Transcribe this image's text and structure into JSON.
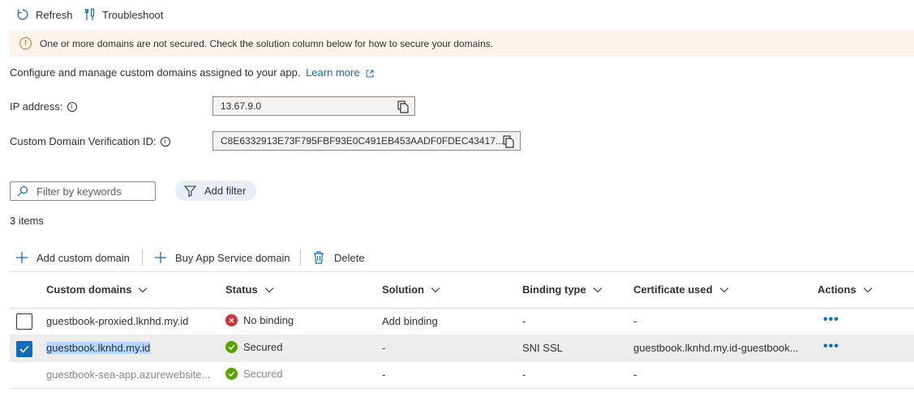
{
  "toolbar": {
    "refresh_label": "Refresh",
    "troubleshoot_label": "Troubleshoot"
  },
  "banner": {
    "message": "One or more domains are not secured. Check the solution column below for how to secure your domains."
  },
  "intro": {
    "text": "Configure and manage custom domains assigned to your app.",
    "learn_more": "Learn more"
  },
  "ip": {
    "label": "IP address:",
    "value": "13.67.9.0"
  },
  "verification": {
    "label": "Custom Domain Verification ID:",
    "value": "C8E6332913E73F795FBF93E0C491EB453AADF0FDEC43417..."
  },
  "filter": {
    "placeholder": "Filter by keywords",
    "add_filter_label": "Add filter"
  },
  "items_count": "3 items",
  "commands": {
    "add_custom_domain": "Add custom domain",
    "buy_domain": "Buy App Service domain",
    "delete": "Delete"
  },
  "table": {
    "headers": [
      "Custom domains",
      "Status",
      "Solution",
      "Binding type",
      "Certificate used",
      "Actions"
    ],
    "rows": [
      {
        "domain": "guestbook-proxied.lknhd.my.id",
        "status": "No binding",
        "status_type": "error",
        "solution": "Add binding",
        "binding": "-",
        "certificate": "-",
        "checked": false,
        "actions": "•••"
      },
      {
        "domain": "guestbook.lknhd.my.id",
        "status": "Secured",
        "status_type": "success",
        "solution": "-",
        "binding": "SNI SSL",
        "certificate": "guestbook.lknhd.my.id-guestbook...",
        "checked": true,
        "actions": "•••"
      },
      {
        "domain": "guestbook-sea-app.azurewebsite...",
        "status": "Secured",
        "status_type": "success",
        "solution": "-",
        "binding": "-",
        "certificate": "-",
        "checked": false,
        "actions": ""
      }
    ]
  },
  "colors": {
    "accent": "#0f6cbd",
    "warning": "#d47500",
    "error": "#d13438",
    "success": "#57a300",
    "banner_bg": "#fdf3ed",
    "selected_row": "#ededed"
  }
}
